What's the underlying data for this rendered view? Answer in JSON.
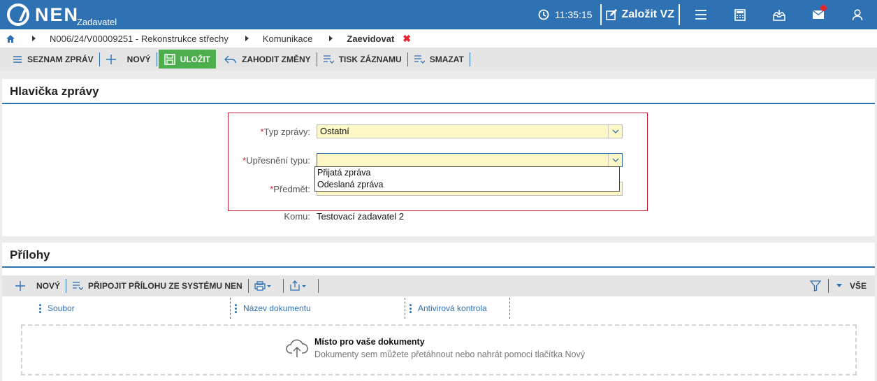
{
  "header": {
    "brand": "NEN",
    "brand_sub": "Zadavatel",
    "time": "11:35:15",
    "create_label": "Založit VZ"
  },
  "breadcrumb": {
    "items": [
      "N006/24/V00009251 - Rekonstrukce střechy",
      "Komunikace"
    ],
    "current": "Zaevidovat",
    "close": "✖"
  },
  "toolbar": {
    "list_label": "SEZNAM ZPRÁV",
    "new_label": "NOVÝ",
    "save_label": "ULOŽIT",
    "discard_label": "ZAHODIT ZMĚNY",
    "print_label": "TISK ZÁZNAMU",
    "delete_label": "SMAZAT"
  },
  "header_section": {
    "title": "Hlavička zprávy",
    "type_label": "Typ zprávy:",
    "type_value": "Ostatní",
    "subtype_label": "Upřesnění typu:",
    "subtype_value": "",
    "subtype_options": [
      "Přijatá zpráva",
      "Odeslaná zpráva"
    ],
    "subject_label": "Předmět:",
    "to_label": "Komu:",
    "to_value": "Testovací zadavatel 2",
    "required_mark": "*"
  },
  "attachments": {
    "title": "Přílohy",
    "new_label": "NOVÝ",
    "attach_label": "PŘIPOJIT PŘÍLOHU ZE SYSTÉMU NEN",
    "all_label": "VŠE",
    "columns": [
      "Soubor",
      "Název dokumentu",
      "Antivirová kontrola"
    ],
    "dropzone_title": "Místo pro vaše dokumenty",
    "dropzone_sub": "Dokumenty sem můžete přetáhnout nebo nahrát pomoci tlačítka Nový"
  },
  "colors": {
    "brand_blue": "#2f72b4",
    "save_green": "#4cae4c",
    "required_red": "#c21f35",
    "field_yellow": "#fdf8c6"
  }
}
